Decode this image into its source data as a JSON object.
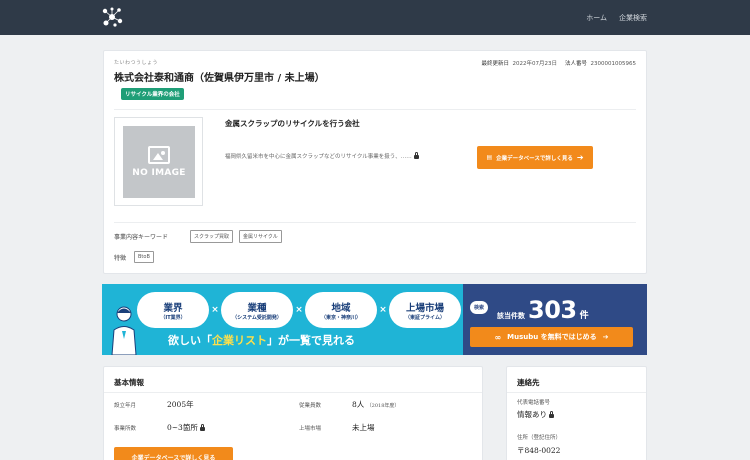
{
  "header": {
    "nav": [
      "ホーム",
      "企業検索"
    ]
  },
  "company": {
    "furigana": "たいわつうしょう",
    "name": "株式会社泰和通商（佐賀県伊万里市 / 未上場）",
    "badge": "リサイクル業界の会社",
    "updated_label": "最終更新日",
    "updated_value": "2022年07月23日",
    "corp_no_label": "法人番号",
    "corp_no_value": "2300001005965",
    "image_text": "NO IMAGE",
    "headline": "金属スクラップのリサイクルを行う会社",
    "description": "福岡県久留米市を中心に金属スクラップなどのリサイクル事業を扱う、……",
    "db_button": "企業データベースで詳しく見る",
    "keywords_label": "事業内容キーワード",
    "keywords": [
      "スクラップ買取",
      "金属リサイクル"
    ],
    "features_label": "特徴",
    "features": [
      "BtoB"
    ]
  },
  "banner": {
    "bubbles": [
      {
        "big": "業界",
        "small": "（IT業界）"
      },
      {
        "big": "業種",
        "small": "（システム受託開発）"
      },
      {
        "big": "地域",
        "small": "（東京・神奈川）"
      },
      {
        "big": "上場市場",
        "small": "（東証プライム）"
      }
    ],
    "times": "×",
    "catch_pre": "欲しい「",
    "catch_hl": "企業リスト",
    "catch_post": "」が一覧で見れる",
    "search_pill": "検索",
    "count_label": "該当件数",
    "count": "303",
    "count_unit": "件",
    "cta": "Musubu を無料ではじめる"
  },
  "basic": {
    "title": "基本情報",
    "founded_label": "設立年月",
    "founded_value": "2005年",
    "employees_label": "従業員数",
    "employees_value": "8人",
    "employees_note": "（2018年度）",
    "offices_label": "事業所数",
    "offices_value": "0~3箇所",
    "market_label": "上場市場",
    "market_value": "未上場",
    "button": "企業データベースで詳しく見る"
  },
  "contact": {
    "title": "連絡先",
    "phone_label": "代表電話番号",
    "phone_value": "情報あり",
    "address_label": "住所（登記住所）",
    "address_value": "〒848-0022"
  }
}
